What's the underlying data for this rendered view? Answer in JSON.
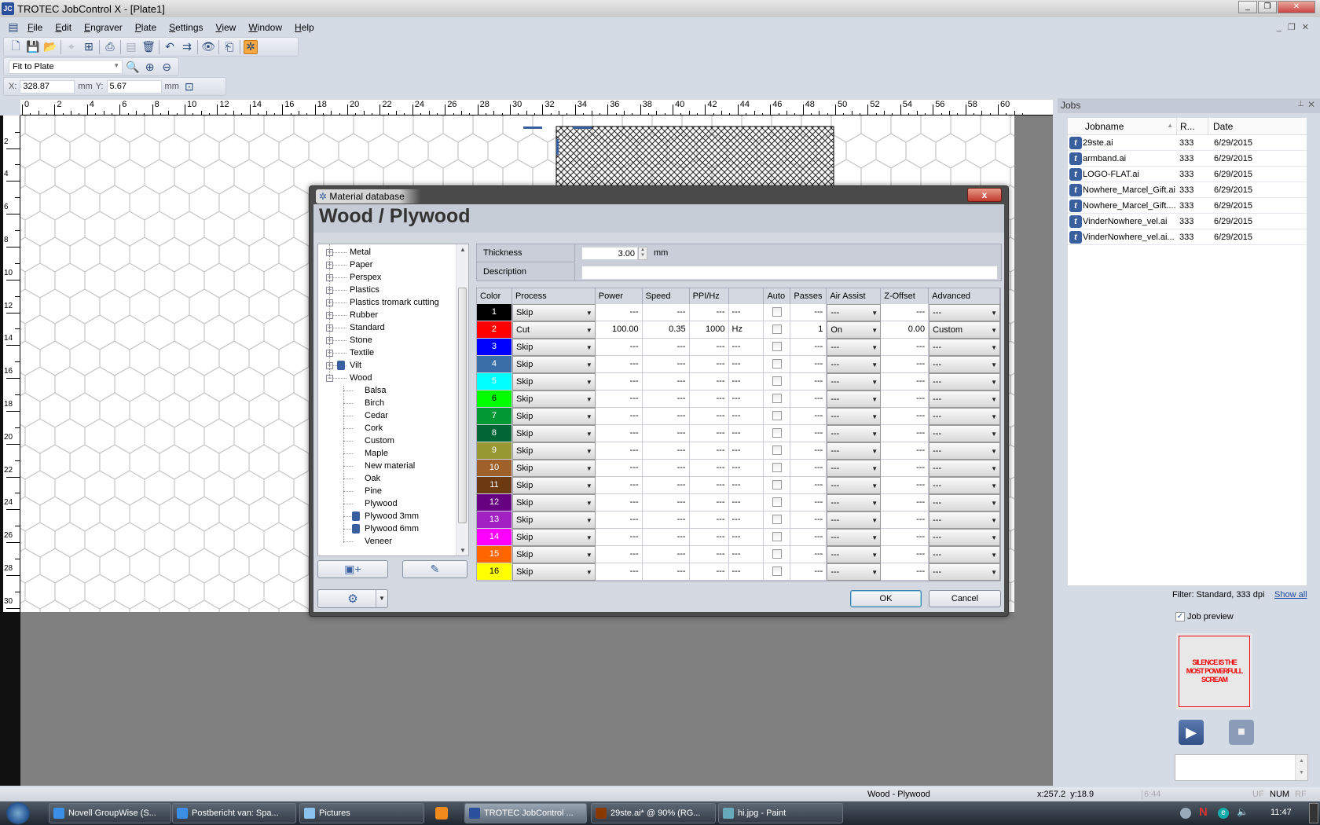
{
  "window": {
    "title": "TROTEC JobControl X - [Plate1]",
    "app_icon": "JC"
  },
  "menu": [
    "File",
    "Edit",
    "Engraver",
    "Plate",
    "Settings",
    "View",
    "Window",
    "Help"
  ],
  "toolbar": {
    "zoom_select": "Fit to Plate",
    "x_label": "X:",
    "x_value": "328.87",
    "x_unit": "mm",
    "y_label": "Y:",
    "y_value": "5.67",
    "y_unit": "mm"
  },
  "ruler": {
    "top": [
      0,
      2,
      4,
      6,
      8,
      10,
      12,
      14,
      16,
      18,
      20,
      22,
      24,
      26,
      28,
      30,
      32,
      34,
      36,
      38,
      40,
      42,
      44,
      46,
      48,
      50,
      52,
      54,
      56,
      58,
      60
    ],
    "left": [
      2,
      4,
      6,
      8,
      10,
      12,
      14,
      16,
      18,
      20,
      22,
      24,
      26,
      28,
      30
    ]
  },
  "dialog": {
    "title": "Material database",
    "close": "x",
    "heading": "Wood / Plywood",
    "tree": [
      {
        "label": "Metal",
        "level": 0
      },
      {
        "label": "Paper",
        "level": 0
      },
      {
        "label": "Perspex",
        "level": 0
      },
      {
        "label": "Plastics",
        "level": 0
      },
      {
        "label": "Plastics tromark cutting",
        "level": 0
      },
      {
        "label": "Rubber",
        "level": 0
      },
      {
        "label": "Standard",
        "level": 0
      },
      {
        "label": "Stone",
        "level": 0
      },
      {
        "label": "Textile",
        "level": 0
      },
      {
        "label": "Vilt",
        "level": 0,
        "locked": true
      },
      {
        "label": "Wood",
        "level": 0,
        "expanded": true
      },
      {
        "label": "Balsa",
        "level": 1
      },
      {
        "label": "Birch",
        "level": 1
      },
      {
        "label": "Cedar",
        "level": 1
      },
      {
        "label": "Cork",
        "level": 1
      },
      {
        "label": "Custom",
        "level": 1
      },
      {
        "label": "Maple",
        "level": 1
      },
      {
        "label": "New material",
        "level": 1
      },
      {
        "label": "Oak",
        "level": 1
      },
      {
        "label": "Pine",
        "level": 1
      },
      {
        "label": "Plywood",
        "level": 1,
        "selected": true
      },
      {
        "label": "Plywood 3mm",
        "level": 1,
        "locked": true
      },
      {
        "label": "Plywood 6mm",
        "level": 1,
        "locked": true
      },
      {
        "label": "Veneer",
        "level": 1
      }
    ],
    "thickness_label": "Thickness",
    "thickness_value": "3.00",
    "thickness_unit": "mm",
    "description_label": "Description",
    "description_value": "",
    "columns": [
      "Color",
      "Process",
      "Power",
      "Speed",
      "PPI/Hz",
      "",
      "Auto",
      "Passes",
      "Air Assist",
      "Z-Offset",
      "Advanced"
    ],
    "rows": [
      {
        "n": "1",
        "color": "#000000",
        "process": "Skip",
        "power": "---",
        "speed": "---",
        "ppi": "---",
        "unit": "---",
        "auto": false,
        "passes": "---",
        "air": "---",
        "z": "---",
        "adv": "---"
      },
      {
        "n": "2",
        "color": "#ff0000",
        "process": "Cut",
        "power": "100.00",
        "speed": "0.35",
        "ppi": "1000",
        "unit": "Hz",
        "auto": false,
        "passes": "1",
        "air": "On",
        "z": "0.00",
        "adv": "Custom"
      },
      {
        "n": "3",
        "color": "#0000ff",
        "process": "Skip",
        "power": "---",
        "speed": "---",
        "ppi": "---",
        "unit": "---",
        "auto": false,
        "passes": "---",
        "air": "---",
        "z": "---",
        "adv": "---"
      },
      {
        "n": "4",
        "color": "#3a6ea8",
        "process": "Skip",
        "power": "---",
        "speed": "---",
        "ppi": "---",
        "unit": "---",
        "auto": false,
        "passes": "---",
        "air": "---",
        "z": "---",
        "adv": "---"
      },
      {
        "n": "5",
        "color": "#00ffff",
        "process": "Skip",
        "power": "---",
        "speed": "---",
        "ppi": "---",
        "unit": "---",
        "auto": false,
        "passes": "---",
        "air": "---",
        "z": "---",
        "adv": "---"
      },
      {
        "n": "6",
        "color": "#00ff00",
        "process": "Skip",
        "power": "---",
        "speed": "---",
        "ppi": "---",
        "unit": "---",
        "auto": false,
        "passes": "---",
        "air": "---",
        "z": "---",
        "adv": "---"
      },
      {
        "n": "7",
        "color": "#009933",
        "process": "Skip",
        "power": "---",
        "speed": "---",
        "ppi": "---",
        "unit": "---",
        "auto": false,
        "passes": "---",
        "air": "---",
        "z": "---",
        "adv": "---"
      },
      {
        "n": "8",
        "color": "#006633",
        "process": "Skip",
        "power": "---",
        "speed": "---",
        "ppi": "---",
        "unit": "---",
        "auto": false,
        "passes": "---",
        "air": "---",
        "z": "---",
        "adv": "---"
      },
      {
        "n": "9",
        "color": "#999933",
        "process": "Skip",
        "power": "---",
        "speed": "---",
        "ppi": "---",
        "unit": "---",
        "auto": false,
        "passes": "---",
        "air": "---",
        "z": "---",
        "adv": "---"
      },
      {
        "n": "10",
        "color": "#a0602a",
        "process": "Skip",
        "power": "---",
        "speed": "---",
        "ppi": "---",
        "unit": "---",
        "auto": false,
        "passes": "---",
        "air": "---",
        "z": "---",
        "adv": "---"
      },
      {
        "n": "11",
        "color": "#6b3a10",
        "process": "Skip",
        "power": "---",
        "speed": "---",
        "ppi": "---",
        "unit": "---",
        "auto": false,
        "passes": "---",
        "air": "---",
        "z": "---",
        "adv": "---"
      },
      {
        "n": "12",
        "color": "#660080",
        "process": "Skip",
        "power": "---",
        "speed": "---",
        "ppi": "---",
        "unit": "---",
        "auto": false,
        "passes": "---",
        "air": "---",
        "z": "---",
        "adv": "---"
      },
      {
        "n": "13",
        "color": "#a020c0",
        "process": "Skip",
        "power": "---",
        "speed": "---",
        "ppi": "---",
        "unit": "---",
        "auto": false,
        "passes": "---",
        "air": "---",
        "z": "---",
        "adv": "---"
      },
      {
        "n": "14",
        "color": "#ff00ff",
        "process": "Skip",
        "power": "---",
        "speed": "---",
        "ppi": "---",
        "unit": "---",
        "auto": false,
        "passes": "---",
        "air": "---",
        "z": "---",
        "adv": "---"
      },
      {
        "n": "15",
        "color": "#ff6600",
        "process": "Skip",
        "power": "---",
        "speed": "---",
        "ppi": "---",
        "unit": "---",
        "auto": false,
        "passes": "---",
        "air": "---",
        "z": "---",
        "adv": "---"
      },
      {
        "n": "16",
        "color": "#ffff00",
        "process": "Skip",
        "power": "---",
        "speed": "---",
        "ppi": "---",
        "unit": "---",
        "auto": false,
        "passes": "---",
        "air": "---",
        "z": "---",
        "adv": "---"
      }
    ],
    "ok": "OK",
    "cancel": "Cancel"
  },
  "jobs": {
    "title": "Jobs",
    "columns": [
      "Jobname",
      "R...",
      "Date"
    ],
    "items": [
      {
        "name": "29ste.ai",
        "r": "333",
        "date": "6/29/2015"
      },
      {
        "name": "armband.ai",
        "r": "333",
        "date": "6/29/2015"
      },
      {
        "name": "LOGO-FLAT.ai",
        "r": "333",
        "date": "6/29/2015"
      },
      {
        "name": "Nowhere_Marcel_Gift.ai",
        "r": "333",
        "date": "6/29/2015"
      },
      {
        "name": "Nowhere_Marcel_Gift....",
        "r": "333",
        "date": "6/29/2015"
      },
      {
        "name": "VinderNowhere_vel.ai",
        "r": "333",
        "date": "6/29/2015"
      },
      {
        "name": "VinderNowhere_vel.ai...",
        "r": "333",
        "date": "6/29/2015"
      }
    ],
    "filter": "Filter: Standard, 333 dpi",
    "show_all": "Show all",
    "job_preview": "Job preview",
    "job_preview_checked": true,
    "preview_text": "SILENCE IS THE MOST POWERFULL SCREAM"
  },
  "status": {
    "material": "Wood - Plywood",
    "coords": "x:257.2  y:18.9",
    "time": "6:44",
    "uf": "UF",
    "num": "NUM",
    "rf": "RF"
  },
  "taskbar": {
    "items": [
      {
        "label": "Novell GroupWise (S...",
        "icon": "ie-icon"
      },
      {
        "label": "Postbericht van: Spa...",
        "icon": "ie-icon"
      },
      {
        "label": "Pictures",
        "icon": "folder-icon"
      },
      {
        "label": "TROTEC JobControl ...",
        "icon": "jobcontrol-icon",
        "active": true
      },
      {
        "label": "29ste.ai* @ 90% (RG...",
        "icon": "illustrator-icon"
      },
      {
        "label": "hi.jpg - Paint",
        "icon": "paint-icon"
      }
    ],
    "clock": "11:47"
  }
}
